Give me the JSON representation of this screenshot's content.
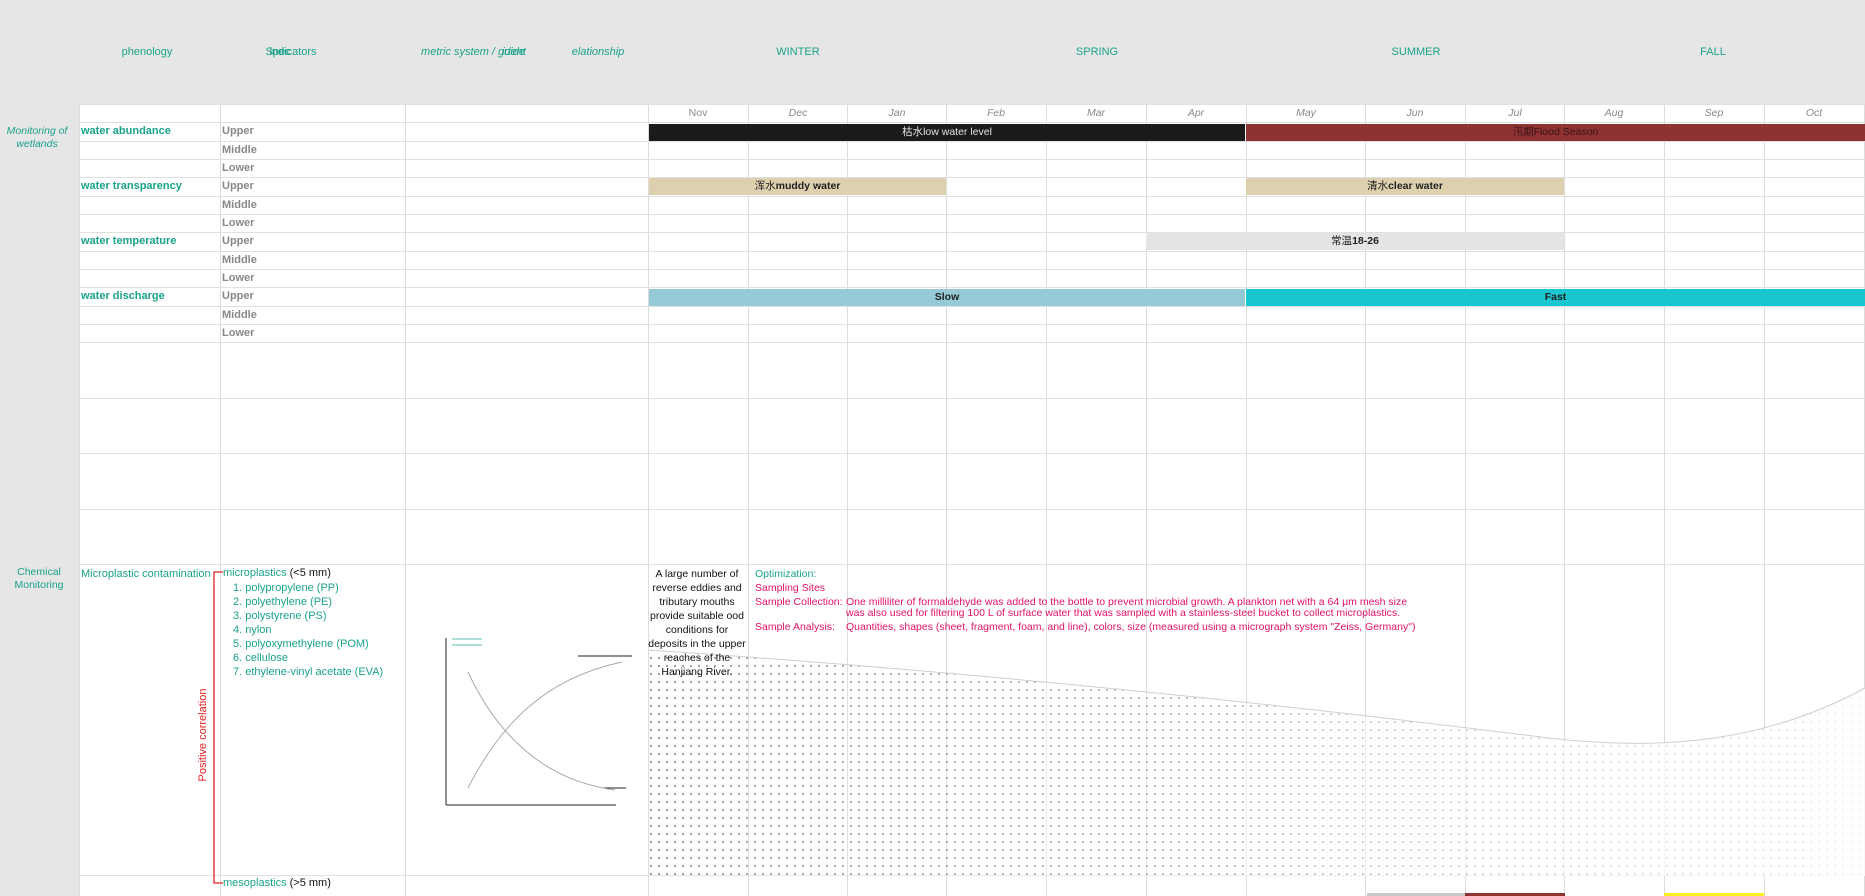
{
  "header": {
    "phenology": "phenology",
    "indicators": "indicators",
    "indicators_overlap": "Spec",
    "metric": "metric system / guide",
    "metric_overlap": "ident",
    "relationship": "elationship",
    "seasons": [
      "WINTER",
      "SPRING",
      "SUMMER",
      "FALL"
    ]
  },
  "months": [
    "Nov",
    "Dec",
    "Jan",
    "Feb",
    "Mar",
    "Apr",
    "May",
    "Jun",
    "Jul",
    "Aug",
    "Sep",
    "Oct"
  ],
  "sections": {
    "wetlands": "Monitoring of wetlands",
    "chemical": "Chemical Monitoring"
  },
  "parameters": [
    {
      "name": "water abundance",
      "levels": [
        "Upper",
        "Middle",
        "Lower"
      ]
    },
    {
      "name": "water transparency",
      "levels": [
        "Upper",
        "Middle",
        "Lower"
      ]
    },
    {
      "name": "water temperature",
      "levels": [
        "Upper",
        "Middle",
        "Lower"
      ]
    },
    {
      "name": "water discharge",
      "levels": [
        "Upper",
        "Middle",
        "Lower"
      ]
    }
  ],
  "bars": {
    "low_water": {
      "cn": "枯水",
      "en": "low water level",
      "color": "#1b1b1b"
    },
    "flood": {
      "cn": "汛期",
      "en": "Flood Season",
      "color": "#8e3232"
    },
    "muddy": {
      "cn": "浑水",
      "en": "muddy water",
      "color": "#dcd0ae"
    },
    "clear": {
      "cn": "清水",
      "en": "clear water",
      "color": "#dcd0ae"
    },
    "temp": {
      "cn": "常温",
      "en": "18-26",
      "color": "#e4e4e4"
    },
    "slow": {
      "label": "Slow",
      "color": "#95c9d6"
    },
    "fast": {
      "label": "Fast",
      "color": "#18c6d0"
    }
  },
  "chemical": {
    "category": "Microplastic contamination",
    "correlation": "Positive correlation",
    "microplastics": {
      "label": "microplastics",
      "size": " (<5 mm)",
      "items": [
        "1. polypropylene (PP)",
        "2. polyethylene (PE)",
        "3. polystyrene (PS)",
        "4. nylon",
        "5. polyoxymethylene (POM)",
        "6. cellulose",
        "7. ethylene-vinyl acetate (EVA)"
      ]
    },
    "mesoplastics": {
      "label": "mesoplastics",
      "size": " (>5 mm)"
    },
    "deposit_text": "A large number of reverse eddies and tributary mouths provide suitable ood conditions for deposits in the upper reaches of the Hanjiang River.",
    "optimization": "Optimization:",
    "sampling_sites": "Sampling Sites",
    "sample_collection_label": "Sample Collection:",
    "sample_collection_line1": "One milliliter of formaldehyde was added to the bottle to prevent microbial growth. A plankton net with a 64 μm mesh size",
    "sample_collection_line2": "was also used for filtering 100 L of surface water that was sampled with a stainless-steel bucket to collect microplastics.",
    "sample_analysis_label": "Sample Analysis:",
    "sample_analysis_text": "Quantities, shapes (sheet, fragment, foam, and line), colors, size (measured using a micrograph system \"Zeiss, Germany\")"
  },
  "colors": {
    "accent": "#1aa38a",
    "pink": "#e2116a",
    "red_bracket": "#e02020",
    "band": "#e6e6e6"
  }
}
